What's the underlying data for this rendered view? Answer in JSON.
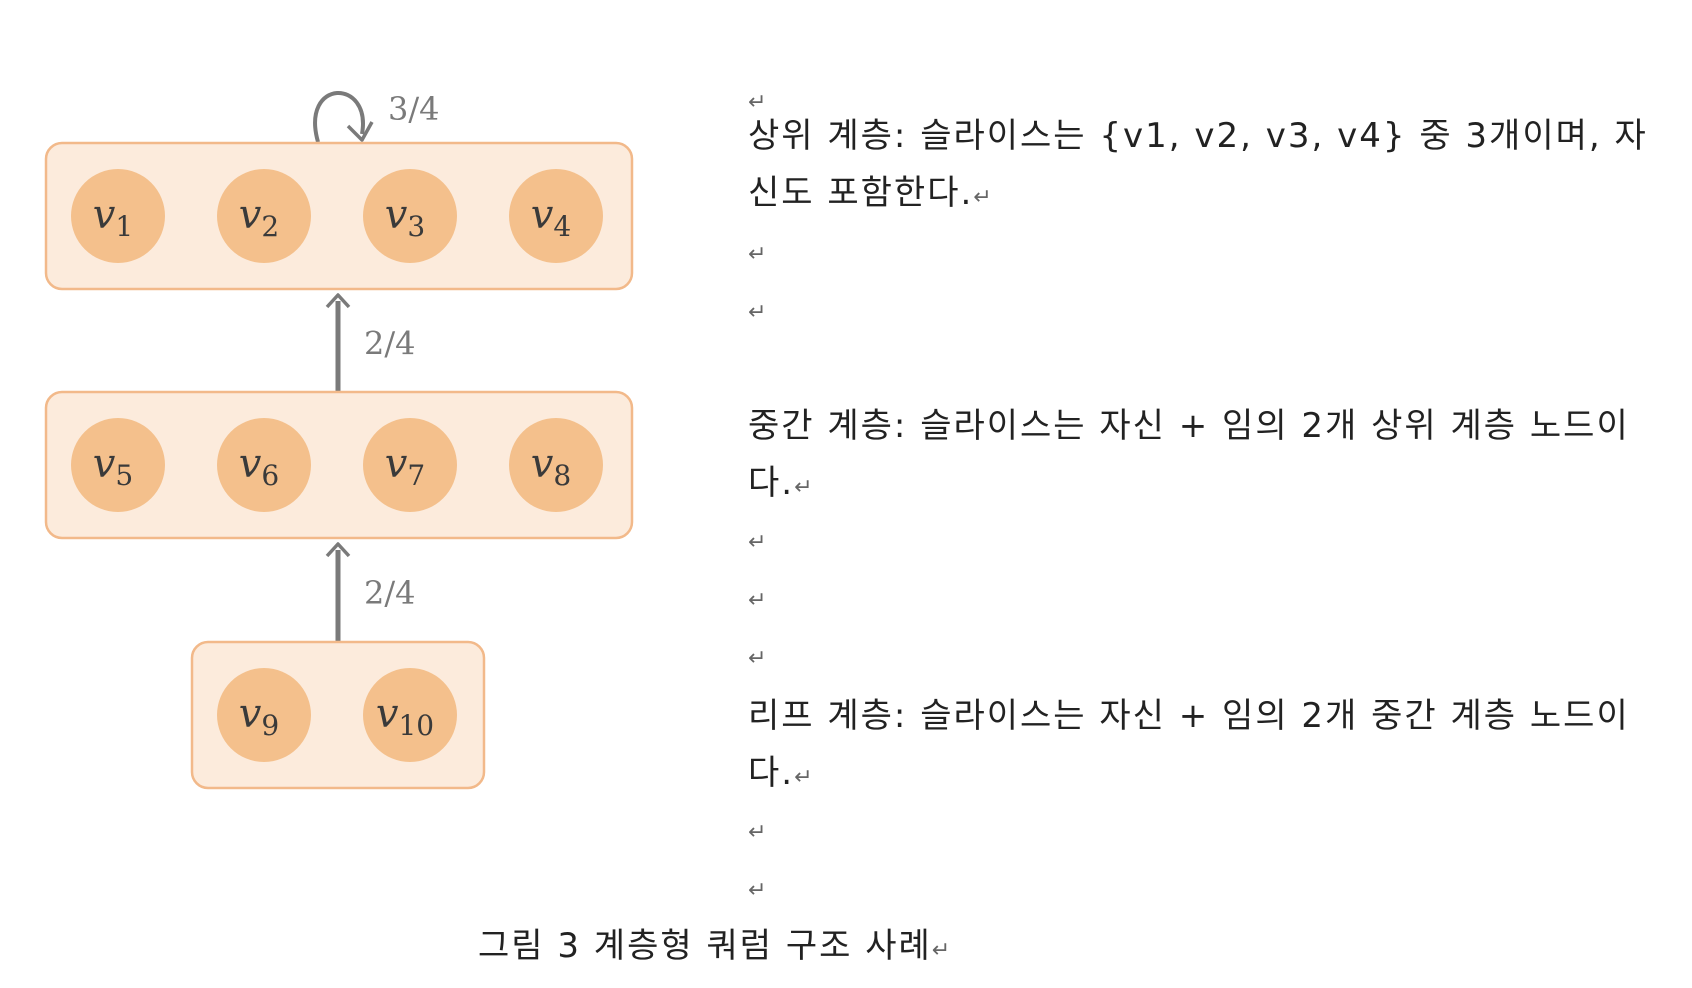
{
  "diagram": {
    "layers": [
      {
        "name": "top",
        "nodes": [
          "v1",
          "v2",
          "v3",
          "v4"
        ]
      },
      {
        "name": "middle",
        "nodes": [
          "v5",
          "v6",
          "v7",
          "v8"
        ]
      },
      {
        "name": "leaf",
        "nodes": [
          "v9",
          "v10"
        ]
      }
    ],
    "edges": [
      {
        "from": "top",
        "to": "top",
        "label": "3/4",
        "kind": "self-loop"
      },
      {
        "from": "middle",
        "to": "top",
        "label": "2/4",
        "kind": "arrow"
      },
      {
        "from": "leaf",
        "to": "middle",
        "label": "2/4",
        "kind": "arrow"
      }
    ],
    "colors": {
      "layer_fill": "#fcebdc",
      "layer_stroke": "#f2b98a",
      "node_fill": "#f4c08c",
      "edge": "#7a7a7a"
    }
  },
  "descriptions": {
    "top": "상위 계층: 슬라이스는 {v1, v2, v3, v4} 중 3개이며, 자신도 포함한다.",
    "middle": "중간 계층: 슬라이스는 자신 + 임의 2개 상위 계층 노드이다.",
    "leaf": "리프 계층: 슬라이스는 자신 + 임의 2개 중간 계층 노드이다."
  },
  "paragraph_mark": "↵",
  "caption": "그림 3 계층형 쿼럼 구조 사례"
}
